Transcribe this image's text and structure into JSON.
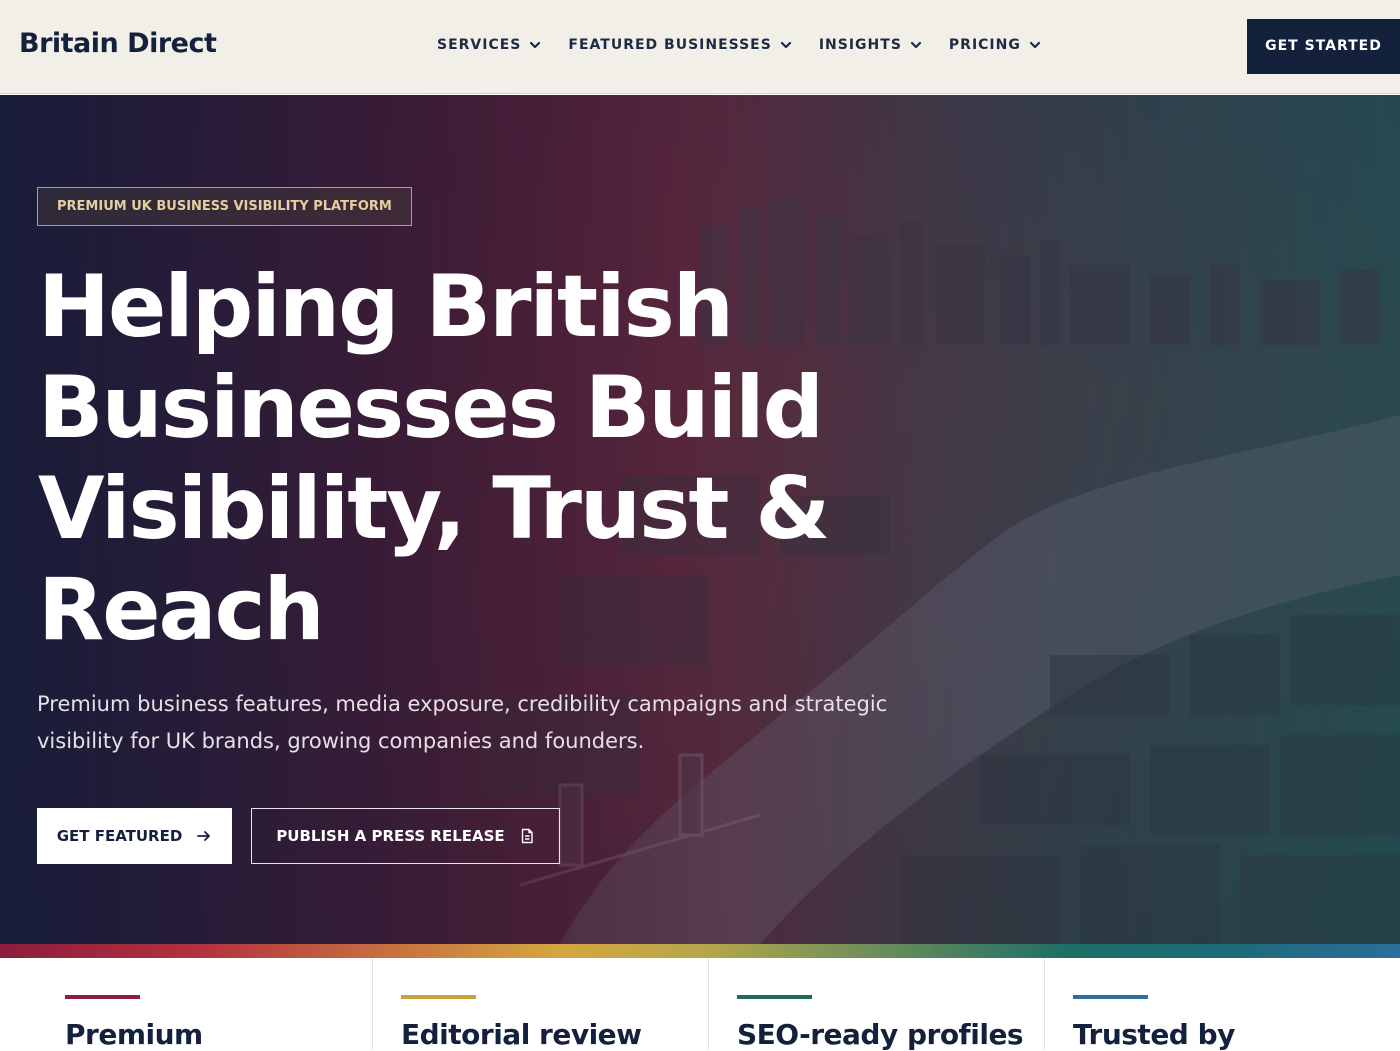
{
  "header": {
    "logo": "Britain Direct",
    "nav": [
      {
        "label": "SERVICES",
        "icon": "chevron-down-icon"
      },
      {
        "label": "FEATURED BUSINESSES",
        "icon": "chevron-down-icon"
      },
      {
        "label": "INSIGHTS",
        "icon": "chevron-down-icon"
      },
      {
        "label": "PRICING",
        "icon": "chevron-down-icon"
      }
    ],
    "cta": "GET STARTED"
  },
  "hero": {
    "eyebrow": "PREMIUM UK BUSINESS VISIBILITY PLATFORM",
    "title_lines": [
      "Helping British",
      "Businesses Build",
      "Visibility, Trust &",
      "Reach"
    ],
    "subtitle": "Premium business features, media exposure, credibility campaigns and strategic visibility for UK brands, growing companies and founders.",
    "primary_button": {
      "label": "GET FEATURED",
      "icon": "arrow-right-icon"
    },
    "secondary_button": {
      "label": "PUBLISH A PRESS RELEASE",
      "icon": "document-icon"
    }
  },
  "features": [
    {
      "title": "Premium",
      "accent_color": "#8c1d3c"
    },
    {
      "title": "Editorial review",
      "accent_color": "#c9a240"
    },
    {
      "title": "SEO-ready profiles",
      "accent_color": "#1f6b5e"
    },
    {
      "title": "Trusted by",
      "accent_color": "#2e6f9e"
    }
  ],
  "colors": {
    "navy": "#14213d",
    "header_bg": "#f2efe9",
    "eyebrow_text": "#e5cf9e"
  }
}
